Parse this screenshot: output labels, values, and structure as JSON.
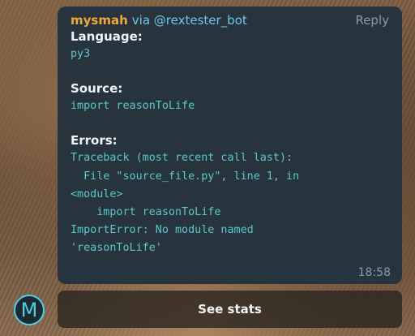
{
  "message": {
    "sender": "mysmah",
    "via_text": "via @rextester_bot",
    "reply_label": "Reply",
    "language_label": "Language:",
    "language_value": "py3",
    "source_label": "Source:",
    "source_value": "import reasonToLife",
    "errors_label": "Errors:",
    "error_lines": [
      "Traceback (most recent call last):",
      "  File \"source_file.py\", line 1, in",
      "<module>",
      "    import reasonToLife",
      "ImportError: No module named",
      "'reasonToLife'"
    ],
    "time": "18:58"
  },
  "avatar": {
    "letter": "M"
  },
  "stats_button": {
    "label": "See stats"
  },
  "colors": {
    "bubble_bg": "#27333d",
    "sender": "#f0a93b",
    "via": "#6fc8e8",
    "code": "#5cc9c8",
    "avatar_accent": "#4fd0e6"
  }
}
